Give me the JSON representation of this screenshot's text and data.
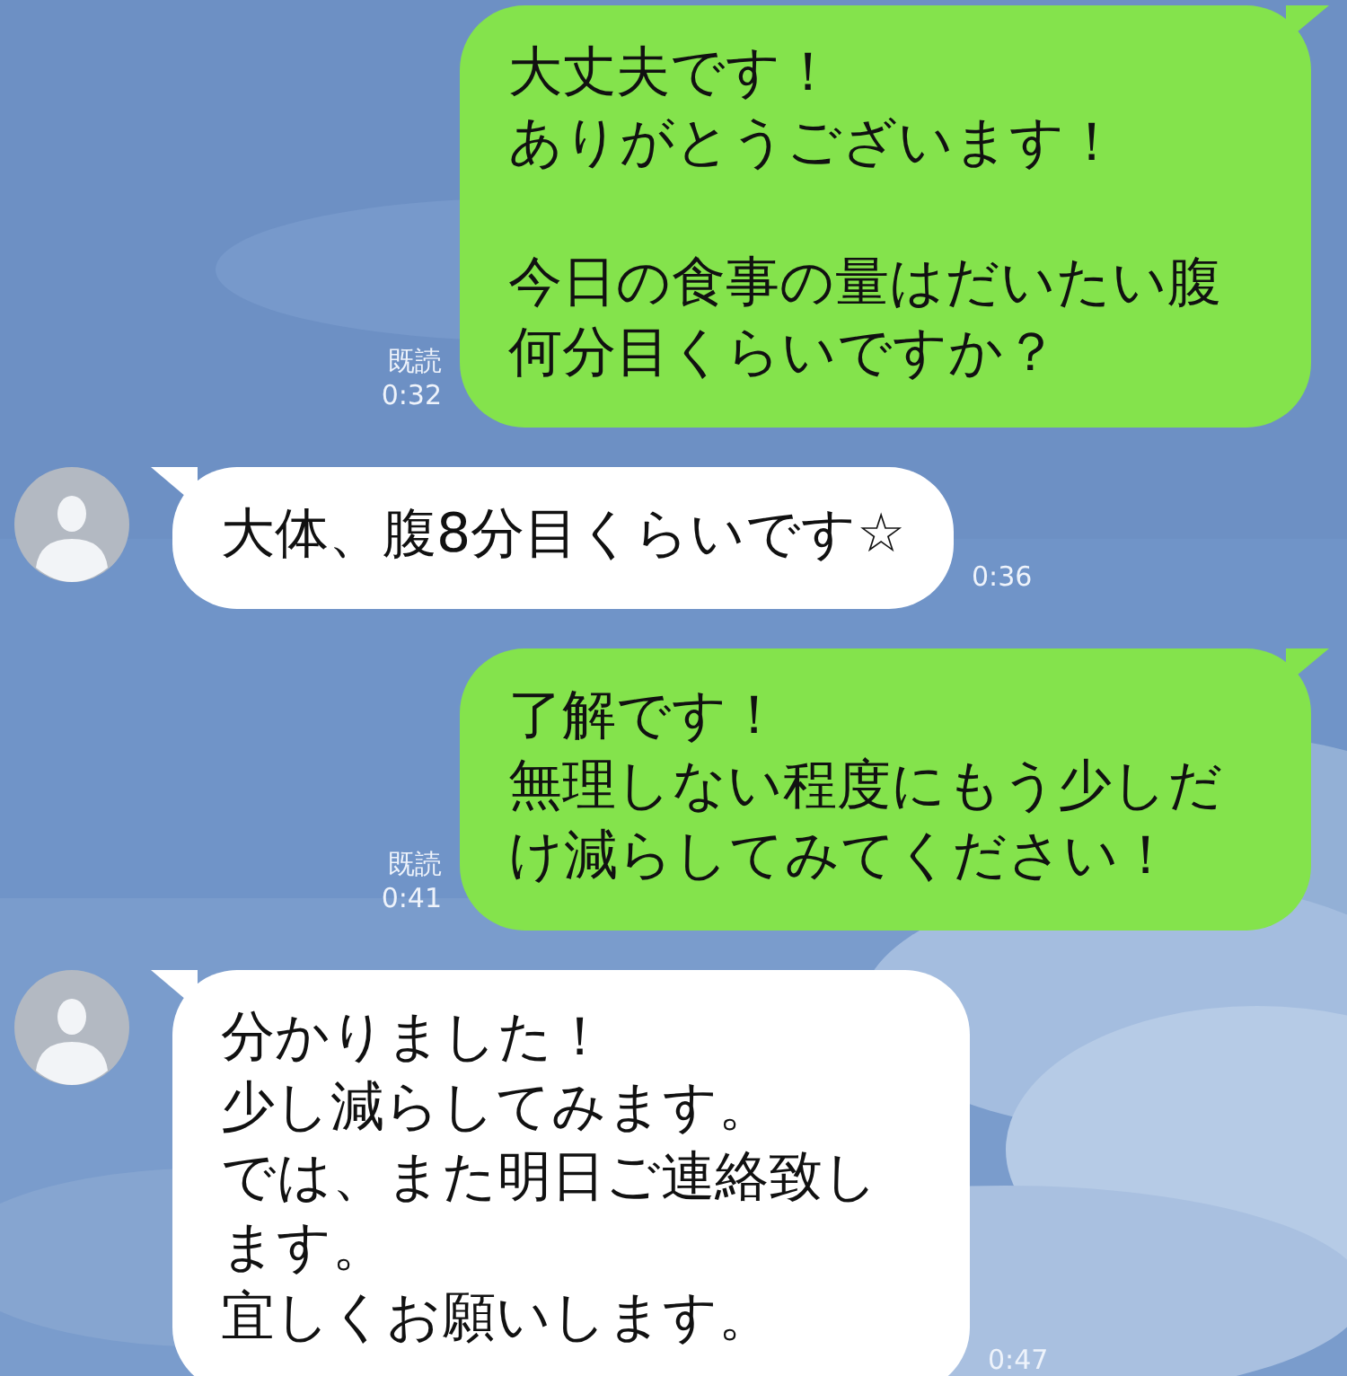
{
  "messages": [
    {
      "kind": "sent",
      "paragraphs": [
        [
          "大丈夫です！",
          "ありがとうございます！"
        ],
        [
          "今日の食事の量はだいたい腹何分目くらいですか？"
        ]
      ],
      "read": "既読",
      "time": "0:32"
    },
    {
      "kind": "received",
      "paragraphs": [
        [
          "大体、腹8分目くらいです☆"
        ]
      ],
      "time": "0:36"
    },
    {
      "kind": "sent",
      "paragraphs": [
        [
          "了解です！",
          "無理しない程度にもう少しだけ減らしてみてください！"
        ]
      ],
      "read": "既読",
      "time": "0:41"
    },
    {
      "kind": "received",
      "paragraphs": [
        [
          "分かりました！",
          "少し減らしてみます。",
          "では、また明日ご連絡致します。",
          "宜しくお願いします。"
        ]
      ],
      "time": "0:47"
    }
  ]
}
